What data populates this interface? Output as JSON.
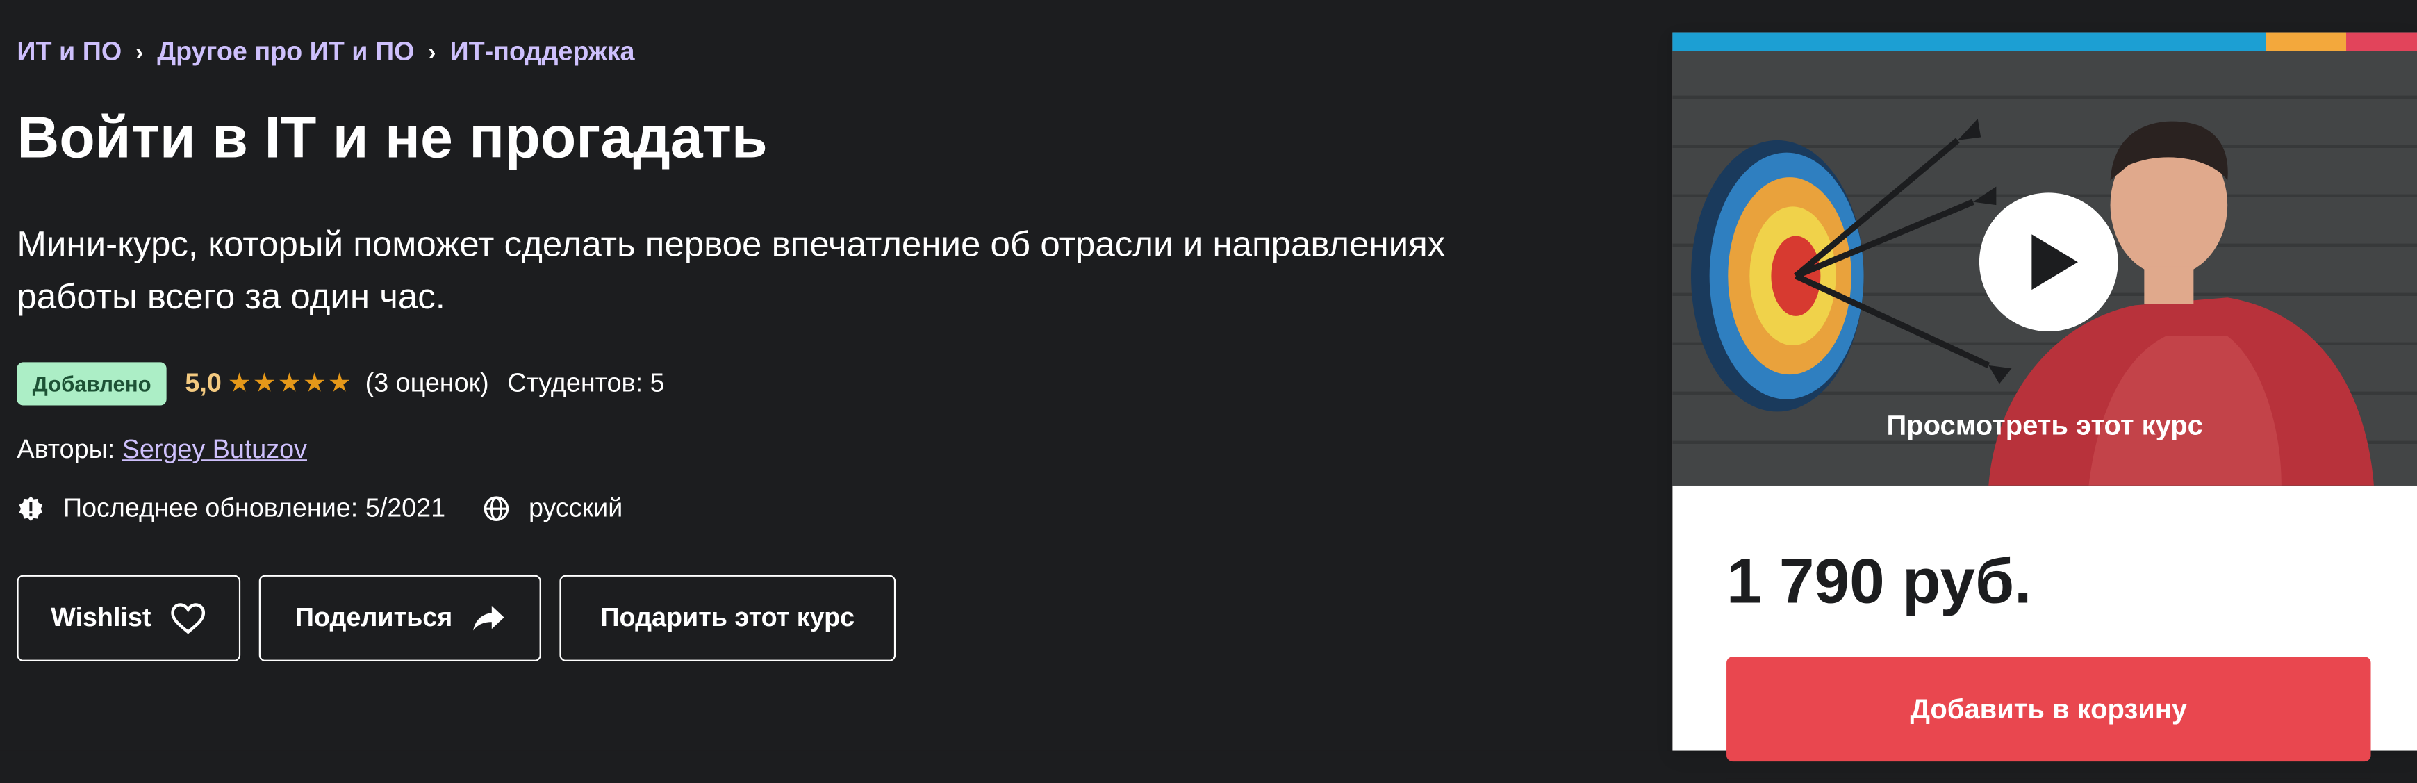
{
  "breadcrumb": [
    "ИТ и ПО",
    "Другое про ИТ и ПО",
    "ИТ-поддержка"
  ],
  "course": {
    "title": "Войти в IT и не прогадать",
    "subtitle": "Мини-курс, который поможет сделать первое впечатление об отрасли и направлениях работы всего за один час.",
    "badge": "Добавлено",
    "rating": "5,0",
    "stars": "★★★★★",
    "ratings_count": "(3 оценок)",
    "students": "Студентов: 5",
    "authors_label": "Авторы:",
    "author": "Sergey Butuzov",
    "last_update": "Последнее обновление: 5/2021",
    "language": "русский"
  },
  "actions": {
    "wishlist": "Wishlist",
    "share": "Поделиться",
    "gift": "Подарить этот курс"
  },
  "sidebar": {
    "preview_label": "Просмотреть этот курс",
    "price": "1 790 руб.",
    "add_to_cart": "Добавить в корзину"
  },
  "colors": {
    "background": "#1c1d1f",
    "link": "#cec0fc",
    "badge_bg": "#aceec6",
    "rating": "#f4ca80",
    "stars": "#e59819",
    "cart_button": "#e9474f",
    "stripe": [
      "#1c9fd3",
      "#1e6fa6",
      "#f3a83c",
      "#e2445b"
    ]
  }
}
